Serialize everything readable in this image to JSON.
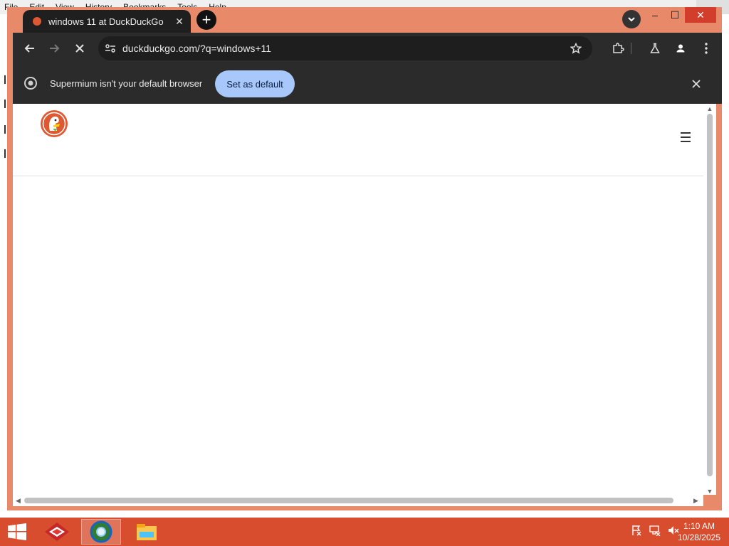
{
  "background_app": {
    "menu": [
      "File",
      "Edit",
      "View",
      "History",
      "Bookmarks",
      "Tools",
      "Help"
    ]
  },
  "browser": {
    "tab": {
      "title": "windows 11 at DuckDuckGo"
    },
    "new_tab_label": "+",
    "omnibox": {
      "url": "duckduckgo.com/?q=windows+11"
    },
    "infobar": {
      "message": "Supermium isn't your default browser",
      "button": "Set as default"
    },
    "colors": {
      "frame": "#e8896a",
      "toolbar": "#2b2b2b",
      "accent_button": "#a8c7fa"
    }
  },
  "page": {
    "site": "DuckDuckGo",
    "logo_icon": "duckduckgo-logo",
    "menu_icon": "hamburger-menu-icon"
  },
  "taskbar": {
    "apps": [
      "pdf-reader-app",
      "supermium-browser-app",
      "file-explorer-app"
    ],
    "clock": {
      "time": "1:10 AM",
      "date": "10/28/2025"
    },
    "colors": {
      "taskbar": "#d74d2e"
    }
  }
}
